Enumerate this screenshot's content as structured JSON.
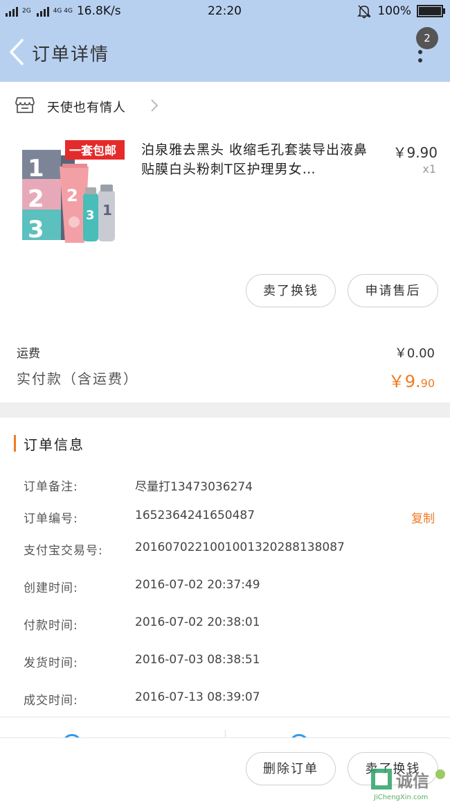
{
  "status_bar": {
    "network_left": "2G",
    "network_right": "4G 4G",
    "speed": "16.8K/s",
    "time": "22:20",
    "battery": "100%",
    "battery_level": 1.0
  },
  "header": {
    "title": "订单详情",
    "badge_count": "2"
  },
  "store": {
    "name": "天使也有情人"
  },
  "product": {
    "image_banner": "一套包邮",
    "title": "泊泉雅去黑头 收缩毛孔套装导出液鼻贴膜白头粉刺T区护理男女…",
    "price": "￥9.90",
    "quantity": "x1"
  },
  "actions": {
    "sell_label": "卖了换钱",
    "after_sale_label": "申请售后"
  },
  "fees": {
    "shipping_label": "运费",
    "shipping_value": "￥0.00",
    "paid_label": "实付款（含运费）",
    "paid_currency_int": "￥9.",
    "paid_decimal": "90"
  },
  "order_info": {
    "title": "订单信息",
    "copy_label": "复制",
    "rows": [
      {
        "label": "订单备注:",
        "value": "尽量打13473036274"
      },
      {
        "label": "订单编号:",
        "value": "1652364241650487"
      },
      {
        "label": "支付宝交易号:",
        "value": "2016070221001001320288138087"
      },
      {
        "label": "创建时间:",
        "value": "2016-07-02 20:37:49"
      },
      {
        "label": "付款时间:",
        "value": "2016-07-02 20:38:01"
      },
      {
        "label": "发货时间:",
        "value": "2016-07-03 08:38:51"
      },
      {
        "label": "成交时间:",
        "value": "2016-07-13 08:39:07"
      }
    ]
  },
  "bottom_bar": {
    "delete_label": "删除订单",
    "sell_label": "卖了换钱"
  },
  "watermark": {
    "text": "诚信",
    "url_text": "JiChengXin.com"
  },
  "colors": {
    "header_bg": "#b8d0f0",
    "accent_orange": "#f07a22",
    "section_gap": "#efefef"
  }
}
